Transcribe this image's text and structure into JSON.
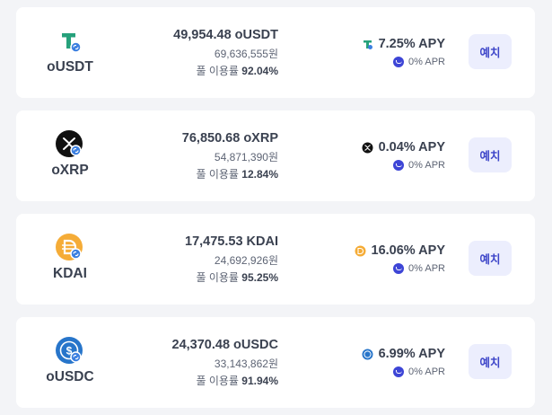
{
  "colors": {
    "page_bg": "#f3f4f7",
    "card_bg": "#ffffff",
    "accent": "#3d45c9",
    "button_bg": "#eceefd",
    "apr_badge": "#3d45d6"
  },
  "pools": [
    {
      "asset": "oUSDT",
      "icon": "tether-icon",
      "amount": "49,954.48 oUSDT",
      "fiat": "69,636,555원",
      "utilization_label": "풀 이용률",
      "utilization_value": "92.04%",
      "apy": "7.25% APY",
      "apr": "0% APR",
      "deposit_label": "예치"
    },
    {
      "asset": "oXRP",
      "icon": "xrp-icon",
      "amount": "76,850.68 oXRP",
      "fiat": "54,871,390원",
      "utilization_label": "풀 이용률",
      "utilization_value": "12.84%",
      "apy": "0.04% APY",
      "apr": "0% APR",
      "deposit_label": "예치"
    },
    {
      "asset": "KDAI",
      "icon": "dai-icon",
      "amount": "17,475.53 KDAI",
      "fiat": "24,692,926원",
      "utilization_label": "풀 이용률",
      "utilization_value": "95.25%",
      "apy": "16.06% APY",
      "apr": "0% APR",
      "deposit_label": "예치"
    },
    {
      "asset": "oUSDC",
      "icon": "usdc-icon",
      "amount": "24,370.48 oUSDC",
      "fiat": "33,143,862원",
      "utilization_label": "풀 이용률",
      "utilization_value": "91.94%",
      "apy": "6.99% APY",
      "apr": "0% APR",
      "deposit_label": "예치"
    }
  ]
}
